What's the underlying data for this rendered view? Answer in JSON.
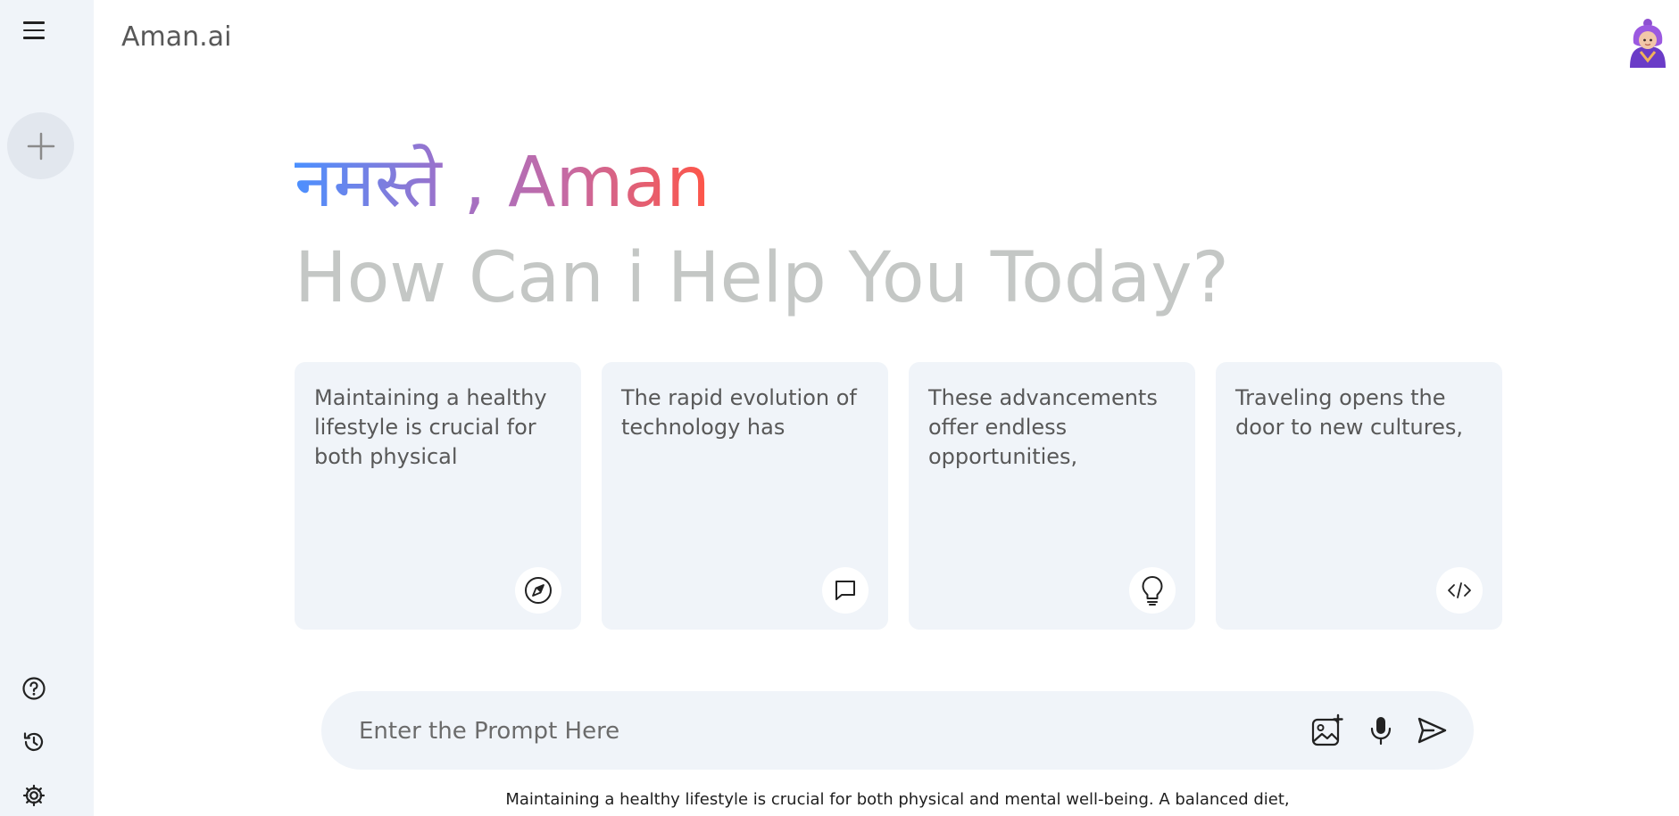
{
  "app": {
    "name": "Aman.ai"
  },
  "sidebar": {
    "menu_icon": "menu-icon",
    "new_chat_icon": "plus-icon",
    "bottom_items": [
      {
        "name": "help",
        "icon": "help-icon"
      },
      {
        "name": "activity",
        "icon": "history-icon"
      },
      {
        "name": "settings",
        "icon": "gear-icon"
      }
    ]
  },
  "greeting": {
    "hello": "नमस्ते , Aman",
    "subtitle": "How Can i Help You Today?",
    "gradient_colors": [
      "#4b90ff",
      "#9b72cb",
      "#c56aa4",
      "#ff5546"
    ]
  },
  "cards": [
    {
      "text": "Maintaining a healthy lifestyle is crucial for both physical",
      "icon": "compass-icon"
    },
    {
      "text": "The rapid evolution of technology has",
      "icon": "message-icon"
    },
    {
      "text": "These advancements offer endless opportunities,",
      "icon": "bulb-icon"
    },
    {
      "text": "Traveling opens the door to new cultures,",
      "icon": "code-icon"
    }
  ],
  "prompt": {
    "placeholder": "Enter the Prompt Here",
    "icons": [
      "gallery-icon",
      "mic-icon",
      "send-icon"
    ]
  },
  "footer": {
    "text": "Maintaining a healthy lifestyle is crucial for both physical and mental well-being. A balanced diet,"
  },
  "colors": {
    "sidebar_bg": "#f0f4f9",
    "card_bg": "#f0f4f9",
    "subtitle": "#c4c7c5"
  }
}
